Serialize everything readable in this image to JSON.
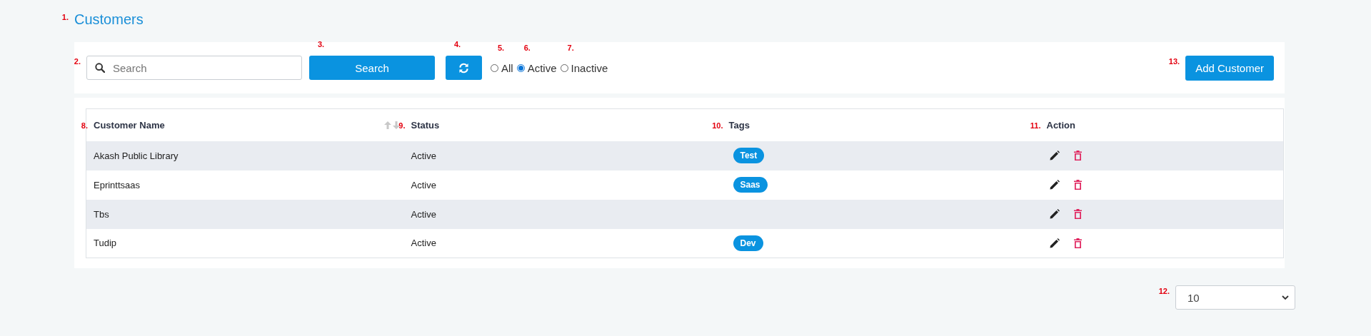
{
  "page": {
    "title": "Customers",
    "marker": "1."
  },
  "toolbar": {
    "search": {
      "placeholder": "Search",
      "marker": "2."
    },
    "search_button": {
      "label": "Search",
      "marker": "3."
    },
    "refresh_button": {
      "marker": "4."
    },
    "filters": [
      {
        "label": "All",
        "selected": false,
        "marker": "5."
      },
      {
        "label": "Active",
        "selected": true,
        "marker": "6."
      },
      {
        "label": "Inactive",
        "selected": false,
        "marker": "7."
      }
    ],
    "add_button": {
      "label": "Add Customer",
      "marker": "13."
    }
  },
  "table": {
    "columns": [
      {
        "label": "Customer Name",
        "marker": "8.",
        "sortable": true
      },
      {
        "label": "Status",
        "marker": "9.",
        "sortable": false
      },
      {
        "label": "Tags",
        "marker": "10.",
        "sortable": false
      },
      {
        "label": "Action",
        "marker": "11.",
        "sortable": false
      }
    ],
    "rows": [
      {
        "name": "Akash Public Library",
        "status": "Active",
        "tags": [
          "Test"
        ]
      },
      {
        "name": "Eprinttsaas",
        "status": "Active",
        "tags": [
          "Saas"
        ]
      },
      {
        "name": "Tbs",
        "status": "Active",
        "tags": []
      },
      {
        "name": "Tudip",
        "status": "Active",
        "tags": [
          "Dev"
        ]
      }
    ]
  },
  "page_size": {
    "value": "10",
    "marker": "12."
  }
}
